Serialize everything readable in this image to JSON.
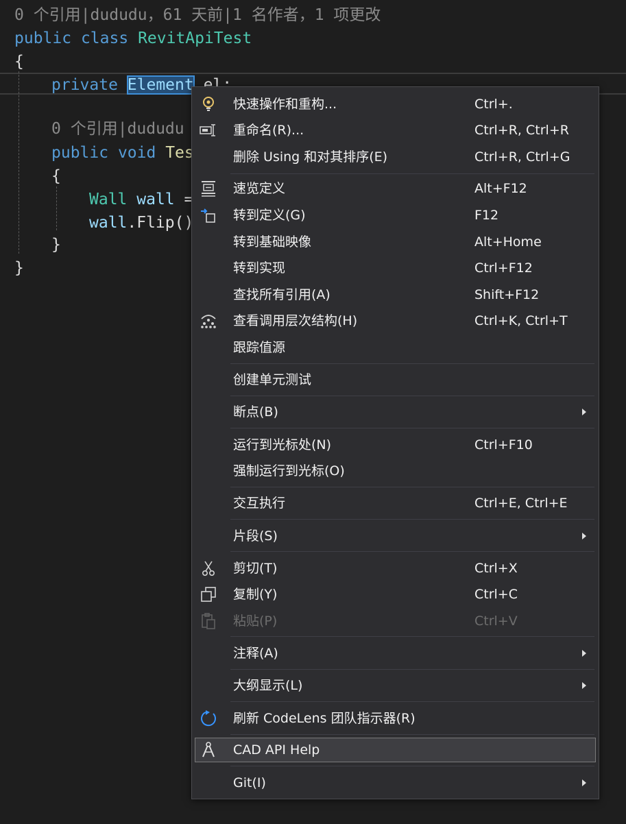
{
  "editor": {
    "codelens_class": "0 个引用|dududu，61 天前|1 名作者，1 项更改",
    "codelens_method": "0 个引用|dududu",
    "line_class": {
      "kw_public": "public",
      "kw_class": "class",
      "class_name": "RevitApiTest"
    },
    "brace_open": "{",
    "brace_close": "}",
    "line_field": {
      "kw_private": "private",
      "type_selected": "Element",
      "rest": " el;"
    },
    "line_method": {
      "kw_public": "public",
      "kw_void": "void",
      "name_partial": "Tes"
    },
    "inner_brace_open": "{",
    "inner_brace_close": "}",
    "line_wall": {
      "type": "Wall",
      "var": "wall",
      "rest": " ="
    },
    "line_flip": {
      "var": "wall",
      "rest": ".Flip()"
    }
  },
  "context_menu": {
    "items": [
      {
        "label": "快速操作和重构...",
        "shortcut": "Ctrl+.",
        "icon": "lightbulb-icon"
      },
      {
        "label": "重命名(R)...",
        "shortcut": "Ctrl+R, Ctrl+R",
        "icon": "rename-icon"
      },
      {
        "label": "删除 Using 和对其排序(E)",
        "shortcut": "Ctrl+R, Ctrl+G",
        "icon": ""
      },
      {
        "label": "速览定义",
        "shortcut": "Alt+F12",
        "icon": "peek-definition-icon"
      },
      {
        "label": "转到定义(G)",
        "shortcut": "F12",
        "icon": "goto-definition-icon"
      },
      {
        "label": "转到基础映像",
        "shortcut": "Alt+Home",
        "icon": ""
      },
      {
        "label": "转到实现",
        "shortcut": "Ctrl+F12",
        "icon": ""
      },
      {
        "label": "查找所有引用(A)",
        "shortcut": "Shift+F12",
        "icon": ""
      },
      {
        "label": "查看调用层次结构(H)",
        "shortcut": "Ctrl+K, Ctrl+T",
        "icon": "call-hierarchy-icon"
      },
      {
        "label": "跟踪值源",
        "shortcut": "",
        "icon": ""
      },
      {
        "label": "创建单元测试",
        "shortcut": "",
        "icon": ""
      },
      {
        "label": "断点(B)",
        "shortcut": "",
        "icon": "",
        "submenu": true
      },
      {
        "label": "运行到光标处(N)",
        "shortcut": "Ctrl+F10",
        "icon": ""
      },
      {
        "label": "强制运行到光标(O)",
        "shortcut": "",
        "icon": ""
      },
      {
        "label": "交互执行",
        "shortcut": "Ctrl+E, Ctrl+E",
        "icon": ""
      },
      {
        "label": "片段(S)",
        "shortcut": "",
        "icon": "",
        "submenu": true
      },
      {
        "label": "剪切(T)",
        "shortcut": "Ctrl+X",
        "icon": "scissors-icon"
      },
      {
        "label": "复制(Y)",
        "shortcut": "Ctrl+C",
        "icon": "copy-icon"
      },
      {
        "label": "粘贴(P)",
        "shortcut": "Ctrl+V",
        "icon": "paste-icon",
        "disabled": true
      },
      {
        "label": "注释(A)",
        "shortcut": "",
        "icon": "",
        "submenu": true
      },
      {
        "label": "大纲显示(L)",
        "shortcut": "",
        "icon": "",
        "submenu": true
      },
      {
        "label": "刷新 CodeLens 团队指示器(R)",
        "shortcut": "",
        "icon": "refresh-icon"
      },
      {
        "label": "CAD API Help",
        "shortcut": "",
        "icon": "compass-icon",
        "highlighted": true
      },
      {
        "label": "Git(I)",
        "shortcut": "",
        "icon": "",
        "submenu": true
      }
    ]
  },
  "colors": {
    "background": "#1e1e1e",
    "menu_background": "#2d2d30",
    "keyword": "#569cd6",
    "type": "#4ec9b0",
    "identifier": "#9cdcfe",
    "selection": "#264f78",
    "refresh_icon": "#3794ff"
  }
}
